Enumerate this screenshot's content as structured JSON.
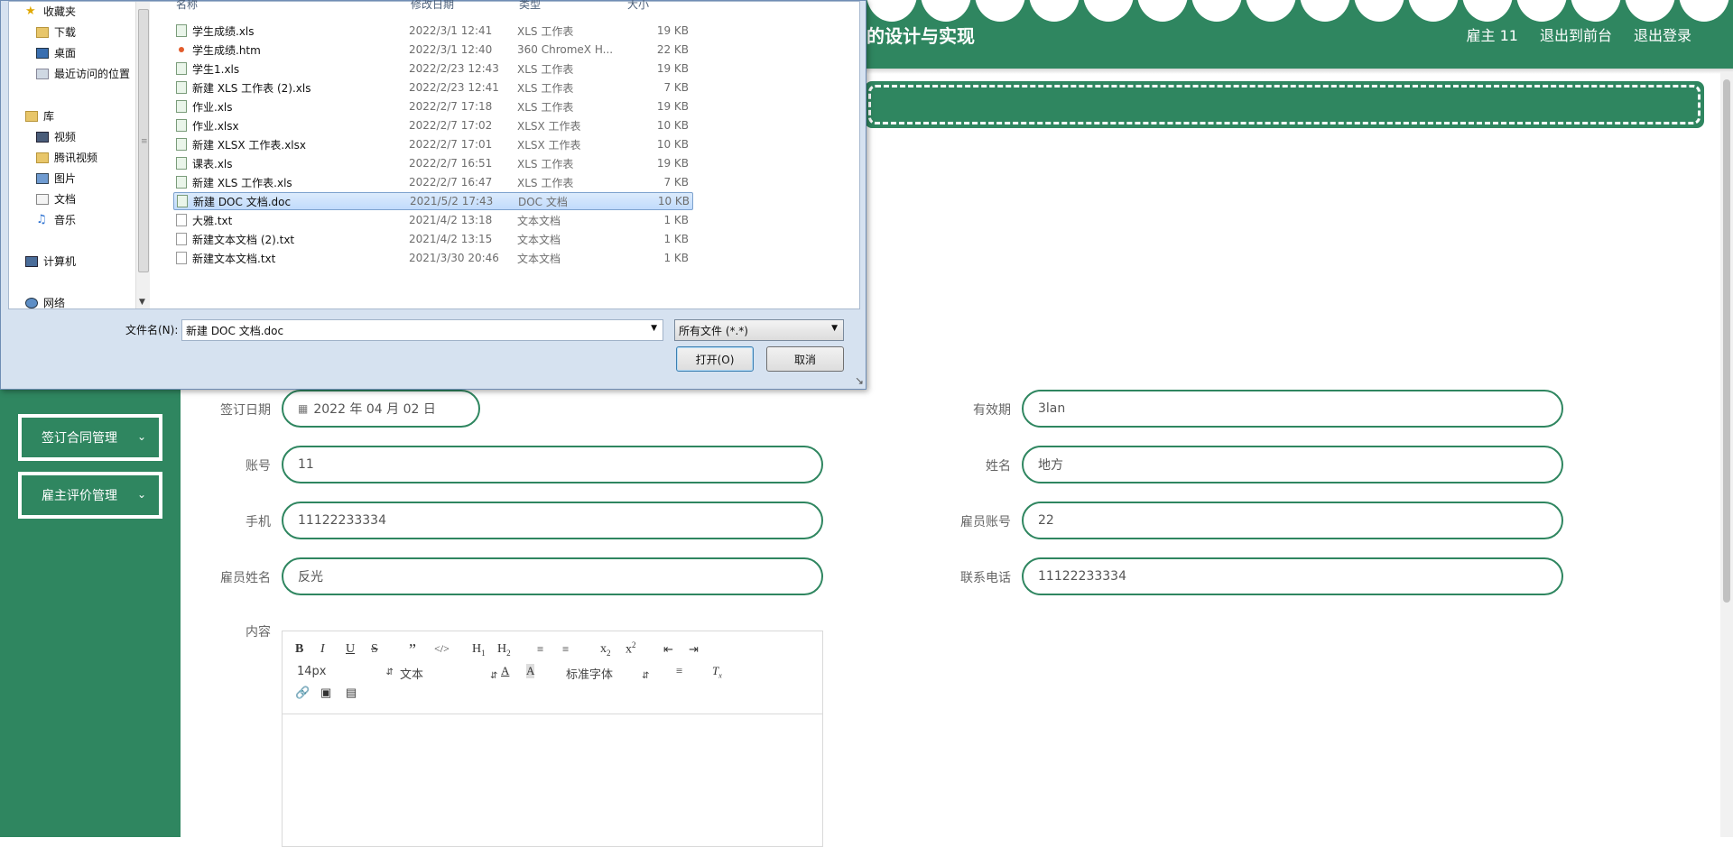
{
  "app": {
    "title": "的设计与实现",
    "user": "雇主 11",
    "link_front": "退出到前台",
    "link_logout": "退出登录"
  },
  "sidebar": {
    "items": [
      {
        "label": "签订合同管理"
      },
      {
        "label": "雇主评价管理"
      }
    ]
  },
  "form": {
    "sign_date_label": "签订日期",
    "sign_date_value": "2022 年 04 月 02 日",
    "validity_label": "有效期",
    "validity_value": "3lan",
    "account_label": "账号",
    "account_value": "11",
    "name_label": "姓名",
    "name_value": "地方",
    "phone_label": "手机",
    "phone_value": "11122233334",
    "employee_account_label": "雇员账号",
    "employee_account_value": "22",
    "employee_name_label": "雇员姓名",
    "employee_name_value": "反光",
    "contact_label": "联系电话",
    "contact_value": "11122233334",
    "content_label": "内容"
  },
  "editor": {
    "font_size": "14px",
    "text_style": "文本",
    "font_family": "标准字体"
  },
  "dialog": {
    "nav": [
      {
        "label": "收藏夹",
        "icon": "star-icon"
      },
      {
        "label": "下载",
        "icon": "folder-icon"
      },
      {
        "label": "桌面",
        "icon": "desktop-icon"
      },
      {
        "label": "最近访问的位置",
        "icon": "recent-icon"
      },
      {
        "label": "库",
        "icon": "library-icon"
      },
      {
        "label": "视频",
        "icon": "video-icon"
      },
      {
        "label": "腾讯视频",
        "icon": "folder-icon"
      },
      {
        "label": "图片",
        "icon": "picture-icon"
      },
      {
        "label": "文档",
        "icon": "document-icon"
      },
      {
        "label": "音乐",
        "icon": "music-icon"
      },
      {
        "label": "计算机",
        "icon": "computer-icon"
      },
      {
        "label": "网络",
        "icon": "network-icon"
      }
    ],
    "columns": {
      "name": "名称",
      "date": "修改日期",
      "type": "类型",
      "size": "大小"
    },
    "files": [
      {
        "name": "学生成绩.xls",
        "date": "2022/3/1 12:41",
        "type": "XLS 工作表",
        "size": "19 KB",
        "kind": "xls"
      },
      {
        "name": "学生成绩.htm",
        "date": "2022/3/1 12:40",
        "type": "360 ChromeX H...",
        "size": "22 KB",
        "kind": "htm"
      },
      {
        "name": "学生1.xls",
        "date": "2022/2/23 12:43",
        "type": "XLS 工作表",
        "size": "19 KB",
        "kind": "xls"
      },
      {
        "name": "新建 XLS 工作表 (2).xls",
        "date": "2022/2/23 12:41",
        "type": "XLS 工作表",
        "size": "7 KB",
        "kind": "xls"
      },
      {
        "name": "作业.xls",
        "date": "2022/2/7 17:18",
        "type": "XLS 工作表",
        "size": "19 KB",
        "kind": "xls"
      },
      {
        "name": "作业.xlsx",
        "date": "2022/2/7 17:02",
        "type": "XLSX 工作表",
        "size": "10 KB",
        "kind": "xls"
      },
      {
        "name": "新建 XLSX 工作表.xlsx",
        "date": "2022/2/7 17:01",
        "type": "XLSX 工作表",
        "size": "10 KB",
        "kind": "xls"
      },
      {
        "name": "课表.xls",
        "date": "2022/2/7 16:51",
        "type": "XLS 工作表",
        "size": "19 KB",
        "kind": "xls"
      },
      {
        "name": "新建 XLS 工作表.xls",
        "date": "2022/2/7 16:47",
        "type": "XLS 工作表",
        "size": "7 KB",
        "kind": "xls"
      },
      {
        "name": "新建 DOC 文档.doc",
        "date": "2021/5/2 17:43",
        "type": "DOC 文档",
        "size": "10 KB",
        "kind": "doc",
        "selected": true
      },
      {
        "name": "大雅.txt",
        "date": "2021/4/2 13:18",
        "type": "文本文档",
        "size": "1 KB",
        "kind": "txt"
      },
      {
        "name": "新建文本文档 (2).txt",
        "date": "2021/4/2 13:15",
        "type": "文本文档",
        "size": "1 KB",
        "kind": "txt"
      },
      {
        "name": "新建文本文档.txt",
        "date": "2021/3/30 20:46",
        "type": "文本文档",
        "size": "1 KB",
        "kind": "txt"
      }
    ],
    "filename_label": "文件名(N):",
    "filename_value": "新建 DOC 文档.doc",
    "filetype_value": "所有文件 (*.*)",
    "open_label": "打开(O)",
    "cancel_label": "取消"
  }
}
